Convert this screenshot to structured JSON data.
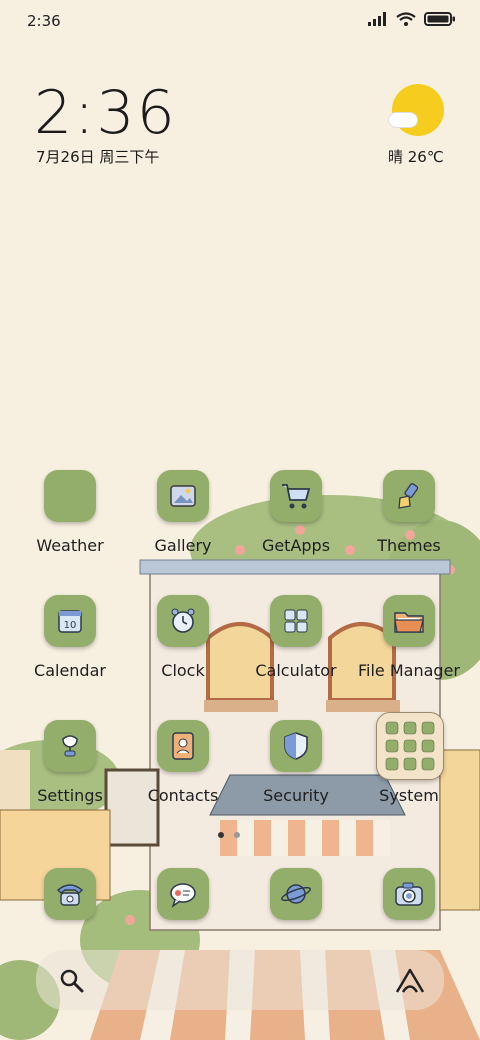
{
  "status_bar": {
    "time": "2:36"
  },
  "clock_widget": {
    "time": "2:36",
    "date": "7月26日 周三下午"
  },
  "weather_widget": {
    "text": "晴 26℃"
  },
  "apps": [
    {
      "label": "Weather"
    },
    {
      "label": "Gallery"
    },
    {
      "label": "GetApps"
    },
    {
      "label": "Themes"
    },
    {
      "label": "Calendar"
    },
    {
      "label": "Clock"
    },
    {
      "label": "Calculator"
    },
    {
      "label": "File Manager"
    },
    {
      "label": "Settings"
    },
    {
      "label": "Contacts"
    },
    {
      "label": "Security"
    },
    {
      "label": "System"
    }
  ],
  "calendar_day": "10",
  "dock": [
    {
      "icon": "phone-icon"
    },
    {
      "icon": "messages-icon"
    },
    {
      "icon": "browser-icon"
    },
    {
      "icon": "camera-icon"
    }
  ],
  "colors": {
    "background": "#f7f0e1",
    "tile": "#93ad6b",
    "sun": "#f6cd1f"
  }
}
